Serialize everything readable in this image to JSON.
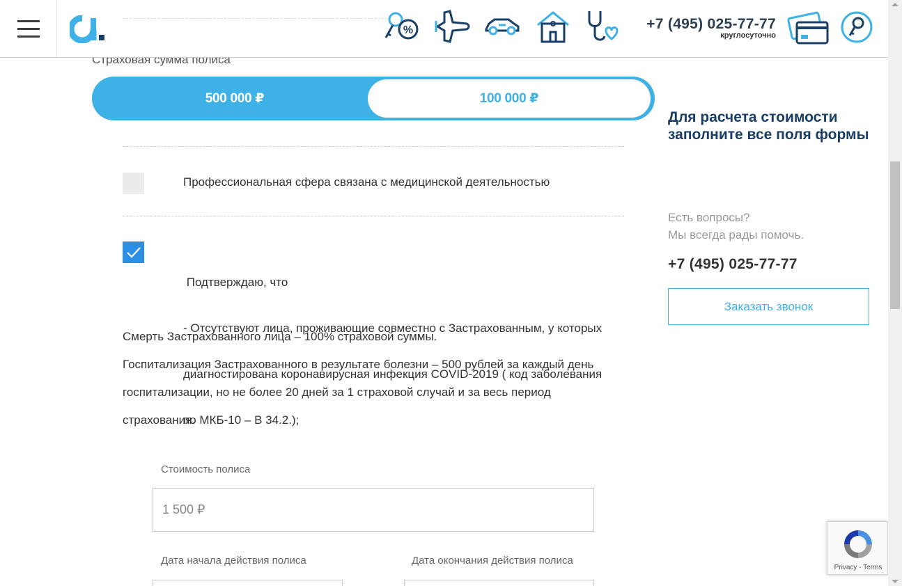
{
  "header": {
    "phone": "+7 (495) 025-77-77",
    "phone_sub": "круглосуточно"
  },
  "form": {
    "sum_label": "Страховая сумма полиса",
    "sum_options": [
      {
        "label": "500 000 ₽",
        "selected": true
      },
      {
        "label": "100 000 ₽",
        "selected": false
      }
    ],
    "checkbox_medical": {
      "label": "Профессиональная сфера связана с медицинской деятельностью",
      "checked": false
    },
    "checkbox_confirm": {
      "checked": true,
      "lines": [
        " Подтверждаю, что",
        "- Отсутствуют лица, проживающие совместно с Застрахованным, у которых",
        "диагностирована коронавирусная инфекция COVID-2019 ( код заболевания",
        "по МКБ-10 – В 34.2.);"
      ]
    },
    "info_lines": [
      "Смерть Застрахованного лица – 100% страховой суммы.",
      "Госпитализация Застрахованного в результате болезни – 500 рублей за каждый день",
      "госпитализации, но не более 20 дней за 1 страховой случай и за весь период",
      "страхования."
    ],
    "cost_label": "Стоимость полиса",
    "cost_value": "1 500 ₽",
    "start_label": "Дата начала действия полиса",
    "end_label": "Дата окончания действия полиса"
  },
  "sidebar": {
    "calc_note": "Для расчета стоимости заполните все поля формы",
    "question_lines": [
      "Есть вопросы?",
      "Мы всегда рады помочь."
    ],
    "phone": "+7 (495) 025-77-77",
    "callback_label": "Заказать звонок"
  },
  "recaptcha": {
    "privacy": "Privacy",
    "separator": " - ",
    "terms": "Terms"
  },
  "colors": {
    "accent": "#3eb1e6",
    "dark_blue": "#1a3f66",
    "checkbox_on": "#2b8fe6"
  }
}
